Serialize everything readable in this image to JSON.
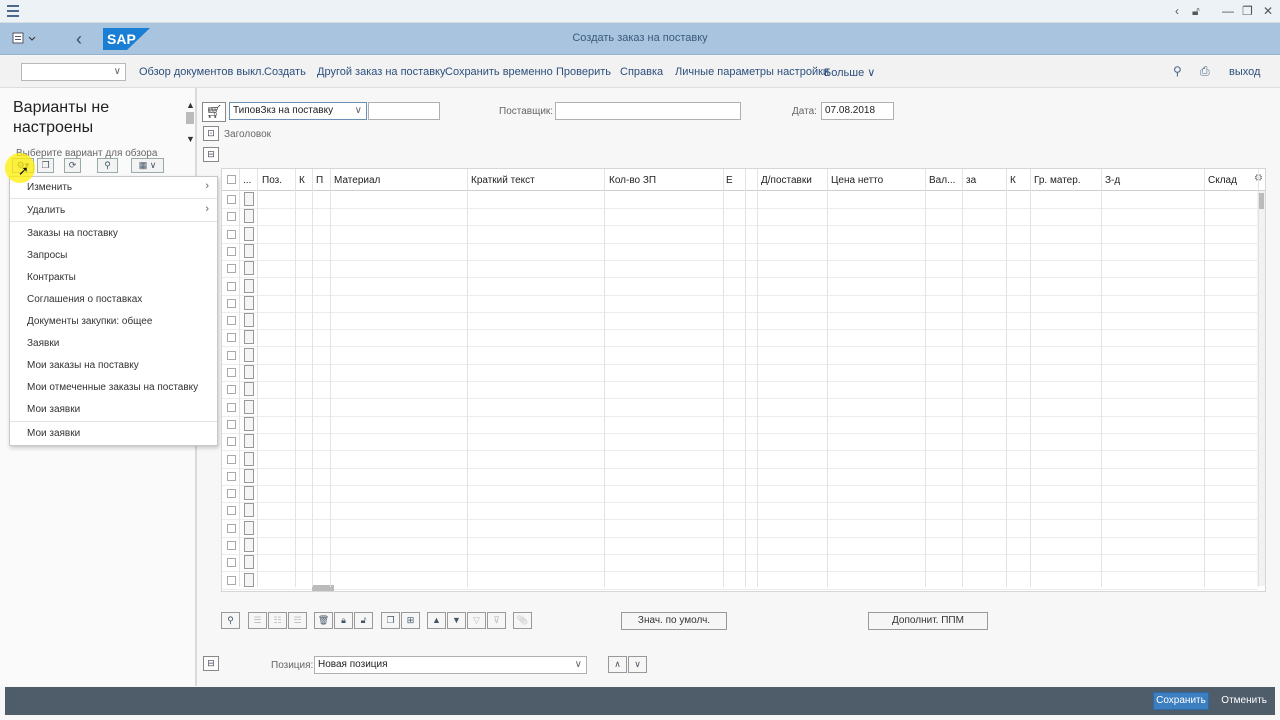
{
  "shell": {
    "title": "Создать заказ на поставку",
    "logo": "SAP"
  },
  "toolbar": {
    "items": [
      "Обзор документов выкл.",
      "Создать",
      "Другой заказ на поставку",
      "Сохранить временно",
      "Проверить",
      "Справка",
      "Личные параметры настройки",
      "Больше"
    ],
    "exit": "выход",
    "icons": [
      "search-icon",
      "print-icon"
    ]
  },
  "left_panel": {
    "heading": "Варианты не настроены",
    "subtitle": "Выберите вариант для обзора"
  },
  "popup": {
    "items": [
      {
        "label": "Изменить",
        "submenu": true
      },
      {
        "label": "Удалить",
        "submenu": true
      },
      {
        "label": "Заказы на поставку",
        "submenu": false
      },
      {
        "label": "Запросы",
        "submenu": false
      },
      {
        "label": "Контракты",
        "submenu": false
      },
      {
        "label": "Соглашения о поставках",
        "submenu": false
      },
      {
        "label": "Документы закупки: общее",
        "submenu": false
      },
      {
        "label": "Заявки",
        "submenu": false
      },
      {
        "label": "Мои заказы на поставку",
        "submenu": false
      },
      {
        "label": "Мои отмеченные заказы на поставку",
        "submenu": false
      },
      {
        "label": "Мои заявки",
        "submenu": false
      },
      {
        "label": "Мои заявки",
        "submenu": false
      }
    ]
  },
  "header": {
    "doc_type": "ТиповЗкз на поставку",
    "doc_number": "",
    "supplier_label": "Поставщик:",
    "supplier_value": "",
    "date_label": "Дата:",
    "date_value": "07.08.2018",
    "header_toggle": "Заголовок"
  },
  "grid": {
    "columns": [
      "...",
      "Поз.",
      "К",
      "П",
      "Материал",
      "Краткий текст",
      "Кол-во ЗП",
      "Е",
      "Д/поставки",
      "Цена нетто",
      "Вал...",
      "за",
      "К",
      "Гр. матер.",
      "З-д",
      "Склад"
    ],
    "visible_rows": 23
  },
  "bottom": {
    "defaults_button": "Знач. по умолч.",
    "addl_button": "Дополнит. ППМ",
    "position_label": "Позиция:",
    "position_value": "Новая позиция"
  },
  "footer": {
    "save": "Сохранить",
    "cancel": "Отменить"
  }
}
